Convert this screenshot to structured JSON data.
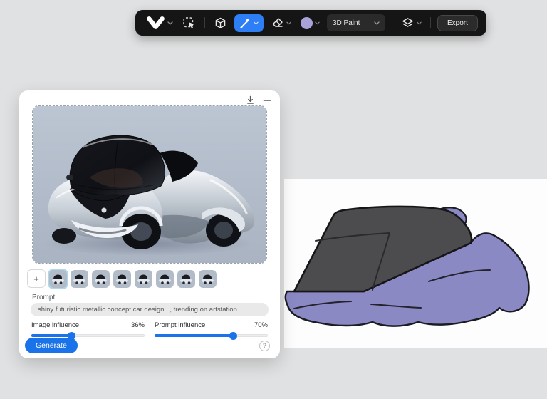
{
  "toolbar": {
    "icons": [
      "vizcom-logo",
      "select-tool",
      "3d-cube",
      "brush-tool",
      "eraser-tool",
      "color-swatch",
      "layers",
      "chevron-down"
    ],
    "active_tool": "brush",
    "accent_color": "#2e7ff6",
    "swatch_color": "#a8a2d9",
    "mode_value": "3D Paint",
    "export_label": "Export"
  },
  "canvas": {
    "sketch_body_color": "#8b89c3",
    "sketch_canopy_color": "#4c4c4e",
    "background": "#fdfdfd"
  },
  "panel": {
    "header_icons": [
      "download-icon",
      "minimize-icon"
    ],
    "image_background": "#b3bdca",
    "thumbnails": {
      "add_label": "+",
      "selected_index": 0,
      "items": [
        "variant-1",
        "variant-2",
        "variant-3",
        "variant-4",
        "variant-5",
        "variant-6",
        "variant-7",
        "variant-8"
      ]
    },
    "prompt": {
      "label": "Prompt",
      "value": "shiny futuristic metallic concept car design ,., trending on artstation"
    },
    "sliders": [
      {
        "label": "Image influence",
        "value": "36%",
        "percent": 36
      },
      {
        "label": "Prompt influence",
        "value": "70%",
        "percent": 70
      }
    ],
    "generate_label": "Generate",
    "help_label": "?",
    "accent_color": "#1a73e8"
  }
}
